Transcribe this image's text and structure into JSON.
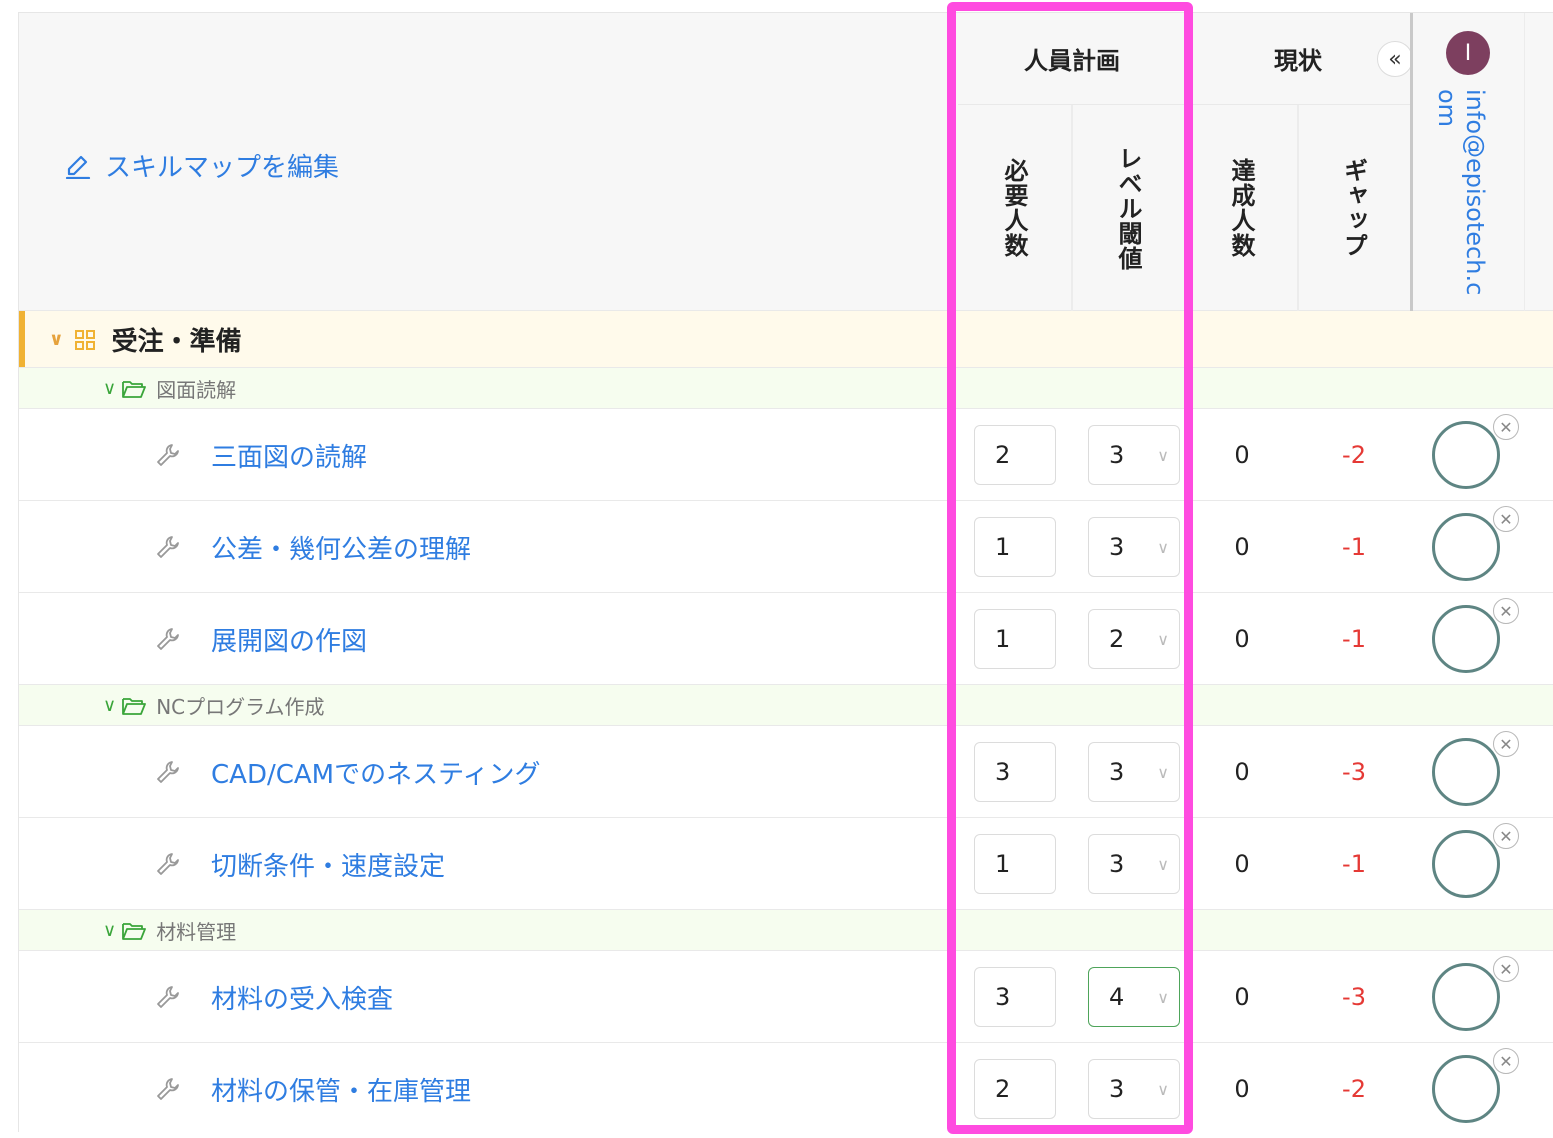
{
  "toolbar": {
    "edit_skillmap_label": "スキルマップを編集"
  },
  "headers": {
    "plan_group": "人員計画",
    "current_group": "現状",
    "required_count": "必要人数",
    "level_threshold": "レベル閾値",
    "achieved_count": "達成人数",
    "gap": "ギャップ",
    "collapse_symbol": "«"
  },
  "user": {
    "initial": "I",
    "email": "info@episotech.com"
  },
  "category": {
    "name": "受注・準備"
  },
  "subcategories": [
    {
      "name": "図面読解"
    },
    {
      "name": "NCプログラム作成"
    },
    {
      "name": "材料管理"
    }
  ],
  "skills": [
    {
      "name": "三面図の読解",
      "required": "2",
      "level": "3",
      "achieved": "0",
      "gap": "-2"
    },
    {
      "name": "公差・幾何公差の理解",
      "required": "1",
      "level": "3",
      "achieved": "0",
      "gap": "-1"
    },
    {
      "name": "展開図の作図",
      "required": "1",
      "level": "2",
      "achieved": "0",
      "gap": "-1"
    },
    {
      "name": "CAD/CAMでのネスティング",
      "required": "3",
      "level": "3",
      "achieved": "0",
      "gap": "-3"
    },
    {
      "name": "切断条件・速度設定",
      "required": "1",
      "level": "3",
      "achieved": "0",
      "gap": "-1"
    },
    {
      "name": "材料の受入検査",
      "required": "3",
      "level": "4",
      "achieved": "0",
      "gap": "-3"
    },
    {
      "name": "材料の保管・在庫管理",
      "required": "2",
      "level": "3",
      "achieved": "0",
      "gap": "-2"
    }
  ],
  "colors": {
    "link": "#2f7de1",
    "gap_negative": "#e53935",
    "highlight": "#ff4be0",
    "category_accent": "#f0b233",
    "avatar": "#7d3f5f"
  },
  "icons": {
    "edit": "pencil-icon",
    "category": "grid-icon",
    "subcategory": "folder-open-icon",
    "skill": "wrench-icon",
    "expand": "chevron-down-icon",
    "clear": "close-icon"
  }
}
